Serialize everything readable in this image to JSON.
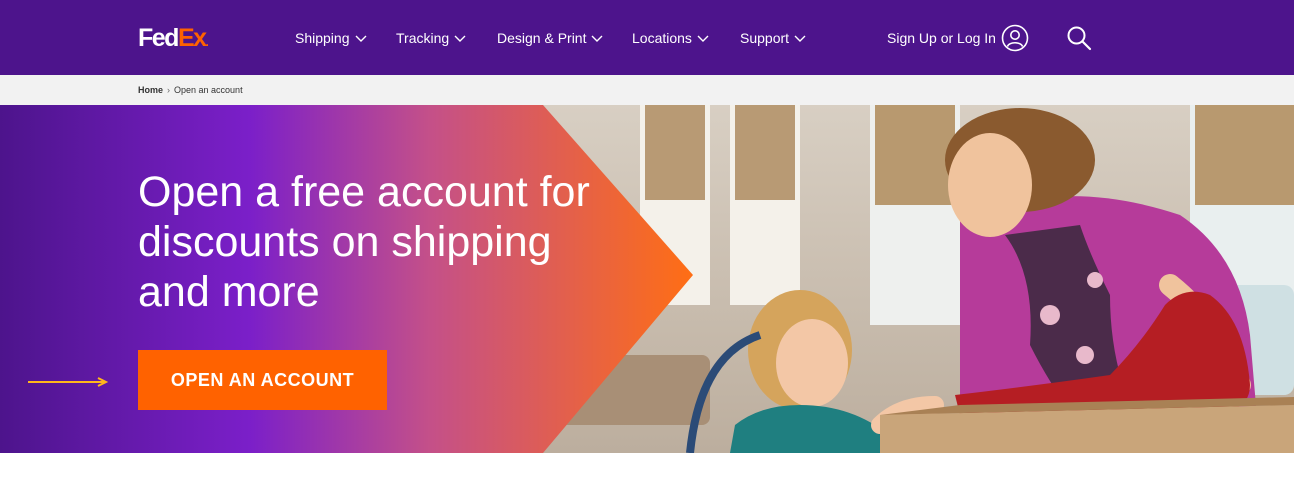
{
  "header": {
    "logo": {
      "part1": "Fed",
      "part2": "Ex",
      "dot": "."
    },
    "nav": [
      {
        "label": "Shipping"
      },
      {
        "label": "Tracking"
      },
      {
        "label": "Design & Print"
      },
      {
        "label": "Locations"
      },
      {
        "label": "Support"
      }
    ],
    "signin_label": "Sign Up or Log In"
  },
  "breadcrumb": {
    "home": "Home",
    "separator": "›",
    "current": "Open an account"
  },
  "hero": {
    "headline": "Open a free account for discounts on shipping and more",
    "cta_label": "OPEN AN ACCOUNT"
  },
  "colors": {
    "brand_purple": "#4d148c",
    "brand_orange": "#ff6200",
    "arrow_yellow": "#ffb71b"
  }
}
